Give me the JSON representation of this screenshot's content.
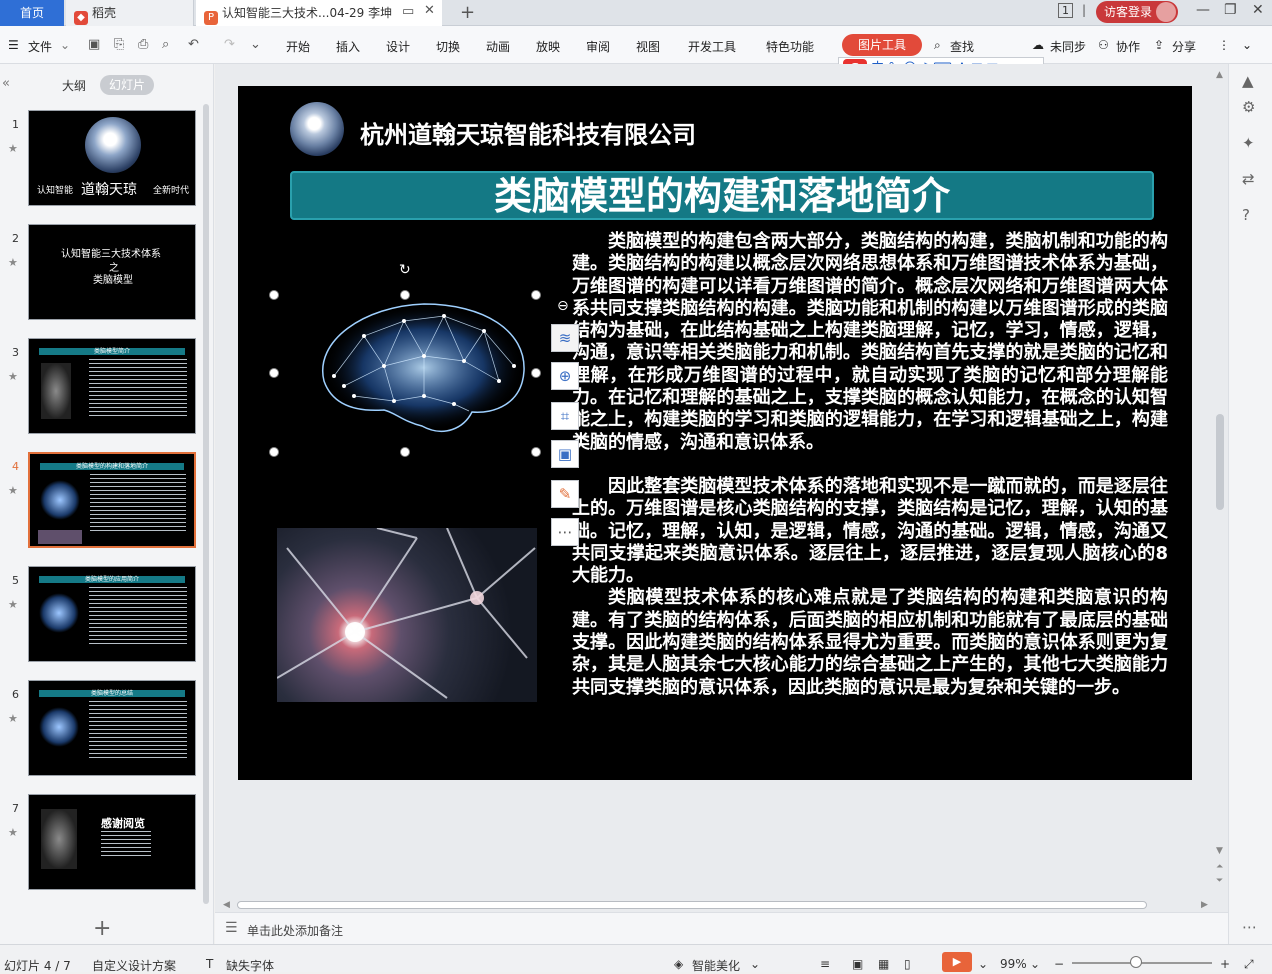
{
  "tabs": {
    "home": "首页",
    "docer": "稻壳",
    "doc": "认知智能三大技术...04-29 李坤",
    "new_tab": "+"
  },
  "titlebar": {
    "page_indicator": "1",
    "login": "访客登录"
  },
  "menu": {
    "file": "文件",
    "items": [
      "开始",
      "插入",
      "设计",
      "切换",
      "动画",
      "放映",
      "审阅",
      "视图",
      "开发工具",
      "特色功能"
    ],
    "picture_tools": "图片工具",
    "search": "查找",
    "unsynced": "未同步",
    "collab": "协作",
    "share": "分享"
  },
  "ime": {
    "s": "S",
    "mode": "中"
  },
  "leftpanel": {
    "tab_outline": "大纲",
    "tab_slides": "幻灯片",
    "slides": [
      {
        "num": "1",
        "t1": "认知智能",
        "t2": "道翰天琼",
        "t3": "全新时代"
      },
      {
        "num": "2",
        "t1": "认知智能三大技术体系",
        "t2": "之",
        "t3": "类脑模型"
      },
      {
        "num": "3",
        "title": "类脑模型简介"
      },
      {
        "num": "4",
        "title": "类脑模型的构建和落地简介"
      },
      {
        "num": "5",
        "title": "类脑模型的应用简介"
      },
      {
        "num": "6",
        "title": "类脑模型的总结"
      },
      {
        "num": "7",
        "title": "感谢阅览"
      }
    ]
  },
  "slide": {
    "company": "杭州道翰天琼智能科技有限公司",
    "title": "类脑模型的构建和落地简介",
    "p1": "类脑模型的构建包含两大部分，类脑结构的构建，类脑机制和功能的构建。类脑结构的构建以概念层次网络思想体系和万维图谱技术体系为基础，万维图谱的构建可以详看万维图谱的简介。概念层次网络和万维图谱两大体系共同支撑类脑结构的构建。类脑功能和机制的构建以万维图谱形成的类脑结构为基础，在此结构基础之上构建类脑理解，记忆，学习，情感，逻辑，沟通，意识等相关类脑能力和机制。类脑结构首先支撑的就是类脑的记忆和理解，在形成万维图谱的过程中，就自动实现了类脑的记忆和部分理解能力。在记忆和理解的基础之上，支撑类脑的概念认知能力，在概念的认知智能之上，构建类脑的学习和类脑的逻辑能力，在学习和逻辑基础之上，构建类脑的情感，沟通和意识体系。",
    "p2": "因此整套类脑模型技术体系的落地和实现不是一蹴而就的，而是逐层往上的。万维图谱是核心类脑结构的支撑，类脑结构是记忆，理解，认知的基础。记忆，理解，认知，是逻辑，情感，沟通的基础。逻辑，情感，沟通又共同支撑起来类脑意识体系。逐层往上，逐层推进，逐层复现人脑核心的8大能力。",
    "p3": "类脑模型技术体系的核心难点就是了类脑结构的构建和类脑意识的构建。有了类脑的结构体系，后面类脑的相应机制和功能就有了最底层的基础支撑。因此构建类脑的结构体系显得尤为重要。而类脑的意识体系则更为复杂，其是人脑其余七大核心能力的综合基础之上产生的，其他七大类脑能力共同支撑类脑的意识体系，因此类脑的意识是最为复杂和关键的一步。"
  },
  "notes": {
    "placeholder": "单击此处添加备注"
  },
  "status": {
    "slide_count": "幻灯片 4 / 7",
    "design": "自定义设计方案",
    "missing_font": "缺失字体",
    "beautify": "智能美化",
    "zoom": "99%"
  },
  "colors": {
    "accent": "#2f6fd6",
    "title_bar": "#147985",
    "picture_tools": "#e24a3a",
    "selected_thumb": "#e2703b"
  }
}
